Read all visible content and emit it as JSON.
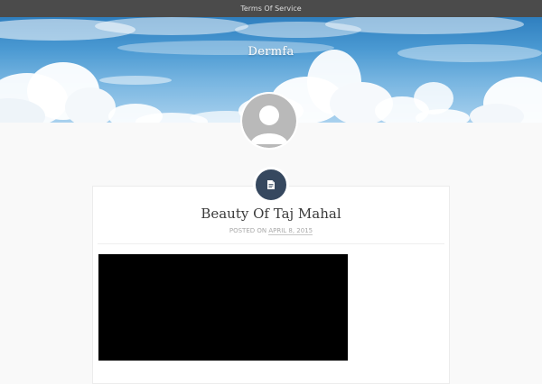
{
  "topbar": {
    "menu_item": "Terms Of Service"
  },
  "header": {
    "site_title": "Dermfa"
  },
  "avatar": {
    "icon": "default-user-icon"
  },
  "post": {
    "format_icon": "document-icon",
    "title": "Beauty Of Taj Mahal",
    "posted_on_label": "POSTED ON",
    "date": "APRIL 8, 2015"
  },
  "media": {
    "type": "embedded-video"
  },
  "colors": {
    "topbar": "#4b4b4b",
    "format_badge": "#36485f",
    "page_background": "#f9f9f9"
  }
}
